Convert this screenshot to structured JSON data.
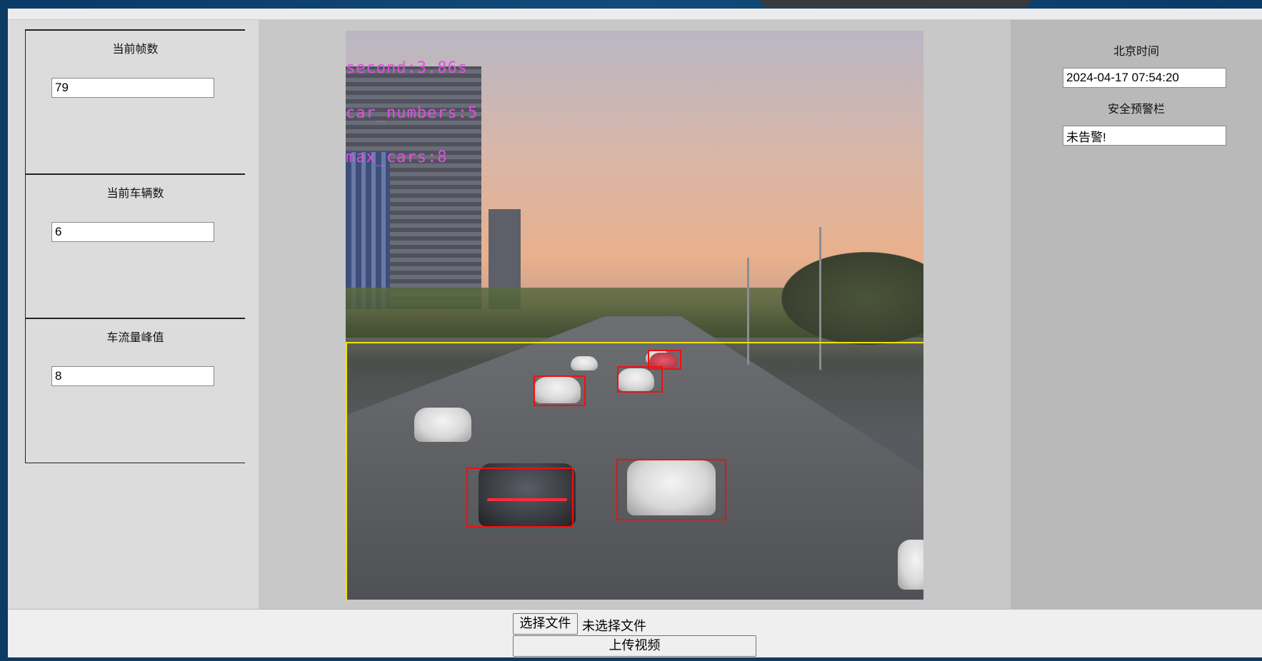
{
  "left_panel": {
    "stats": [
      {
        "label": "当前帧数",
        "value": "79"
      },
      {
        "label": "当前车辆数",
        "value": "6"
      },
      {
        "label": "车流量峰值",
        "value": "8"
      }
    ]
  },
  "video": {
    "overlay_lines": [
      "second:3.86s",
      "car_numbers:5",
      "max_cars:8"
    ],
    "overlay_color": "#e04fe0",
    "roi_color": "#f2e300",
    "box_color": "#e11"
  },
  "right_panel": {
    "time_label": "北京时间",
    "time_value": "2024-04-17 07:54:20",
    "alert_label": "安全预警栏",
    "alert_value": "未告警!"
  },
  "upload": {
    "choose_file_label": "选择文件",
    "file_status": "未选择文件",
    "upload_label": "上传视频"
  }
}
